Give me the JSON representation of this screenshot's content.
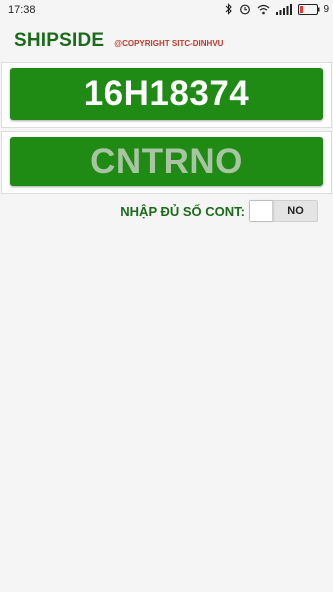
{
  "status_bar": {
    "time": "17:38",
    "battery_level": "9",
    "icons": [
      "bluetooth-icon",
      "alarm-icon",
      "wifi-icon",
      "signal-icon",
      "battery-icon"
    ]
  },
  "header": {
    "title": "SHIPSIDE",
    "copyright": "@COPYRIGHT SITC-DINHVU"
  },
  "vehicle_plate": {
    "value": "16H18374"
  },
  "container_number": {
    "placeholder": "CNTRNO"
  },
  "full_cont_toggle": {
    "label": "NHẬP ĐỦ SỐ CONT:",
    "state": "NO"
  },
  "colors": {
    "primary_green": "#1f8a14",
    "title_green": "#1b6b1b",
    "copyright_red": "#c0392b"
  }
}
